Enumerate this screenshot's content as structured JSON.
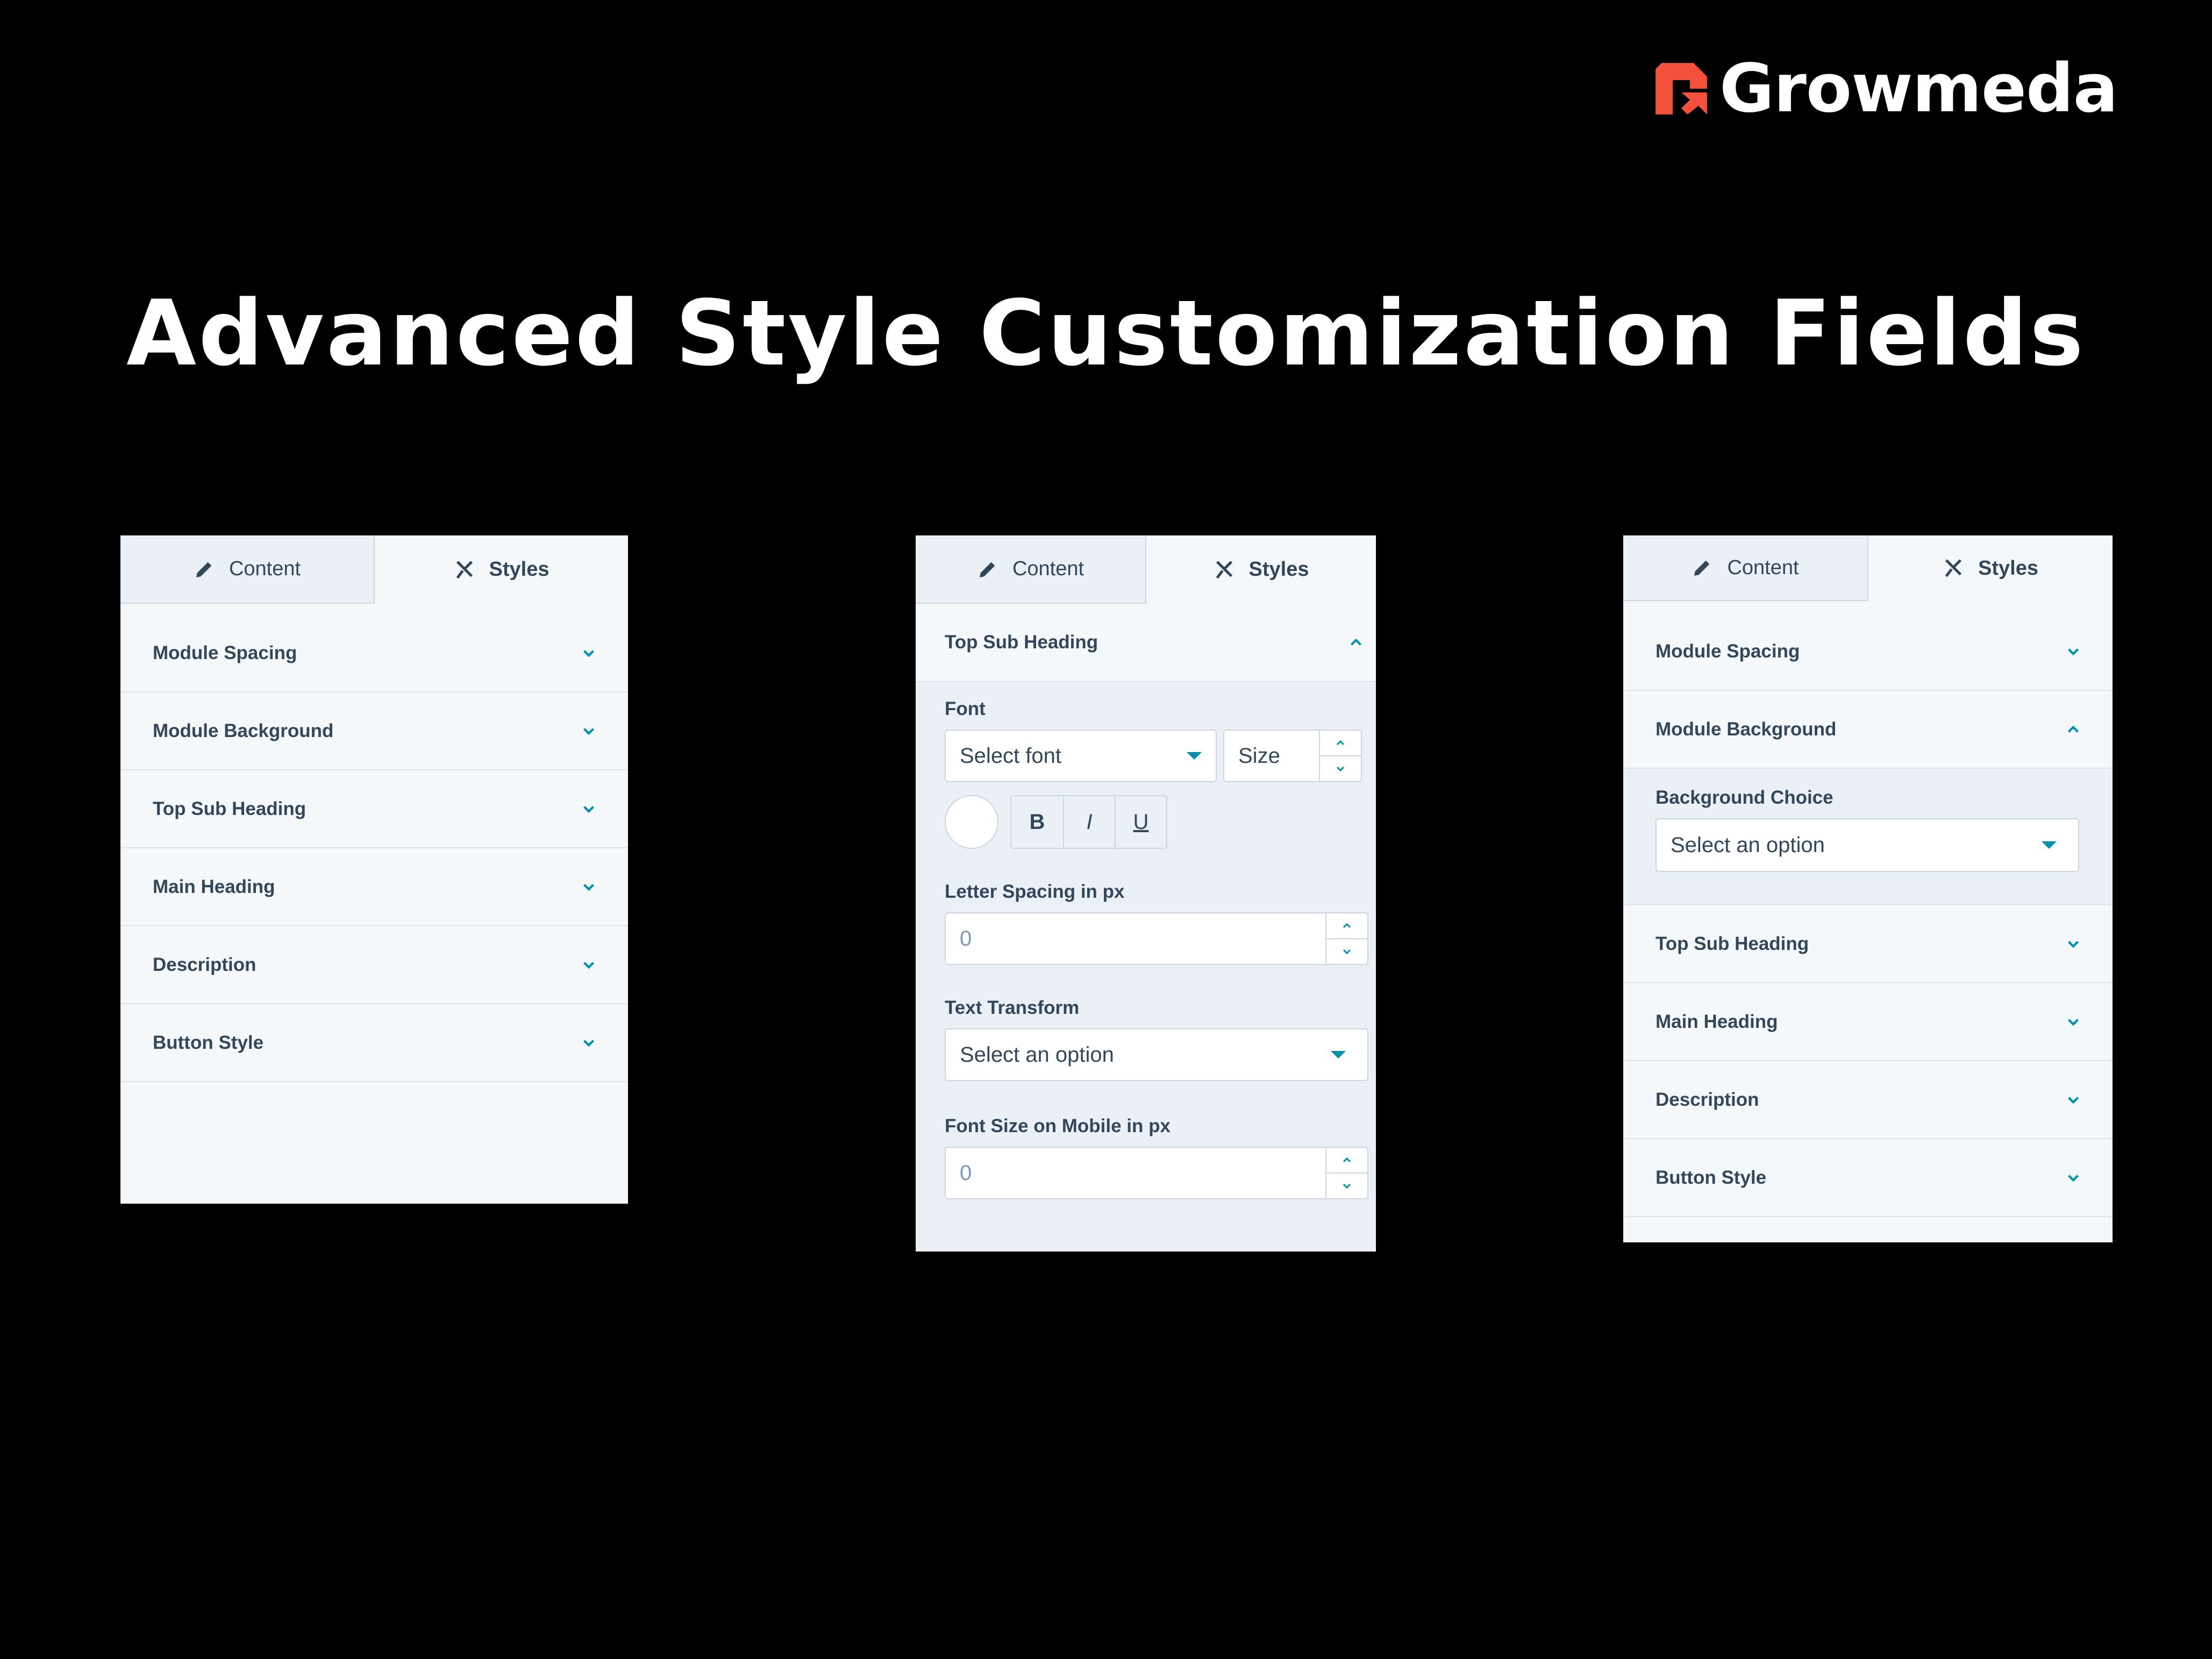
{
  "brand": {
    "name": "Growmeda",
    "accent": "#f4513c"
  },
  "page_title": "Advanced Style Customization Fields",
  "tabs": {
    "content": "Content",
    "styles": "Styles"
  },
  "panel1": {
    "rows": [
      "Module Spacing",
      "Module Background",
      "Top Sub Heading",
      "Main Heading",
      "Description",
      "Button Style"
    ]
  },
  "panel2": {
    "section_title": "Top Sub Heading",
    "font_label": "Font",
    "font_placeholder": "Select font",
    "size_placeholder": "Size",
    "format_buttons": {
      "bold": "B",
      "italic": "I",
      "underline": "U"
    },
    "letter_spacing_label": "Letter Spacing in px",
    "letter_spacing_value": "0",
    "text_transform_label": "Text Transform",
    "text_transform_placeholder": "Select an option",
    "mobile_size_label": "Font Size on Mobile in px",
    "mobile_size_value": "0"
  },
  "panel3": {
    "rows_before": [
      "Module Spacing",
      "Module Background"
    ],
    "background_choice_label": "Background Choice",
    "background_choice_placeholder": "Select an option",
    "rows_after": [
      "Top Sub Heading",
      "Main Heading",
      "Description",
      "Button Style"
    ]
  },
  "icons": {
    "tab_content": "pencil-icon",
    "tab_styles": "brush-icon",
    "row_toggle": "chevron-down-icon",
    "row_open": "chevron-up-icon"
  },
  "colors": {
    "chevron": "#0091ae",
    "panel_bg": "#f5f8fa",
    "section_bg": "#eaf0f6",
    "text": "#33475b"
  }
}
